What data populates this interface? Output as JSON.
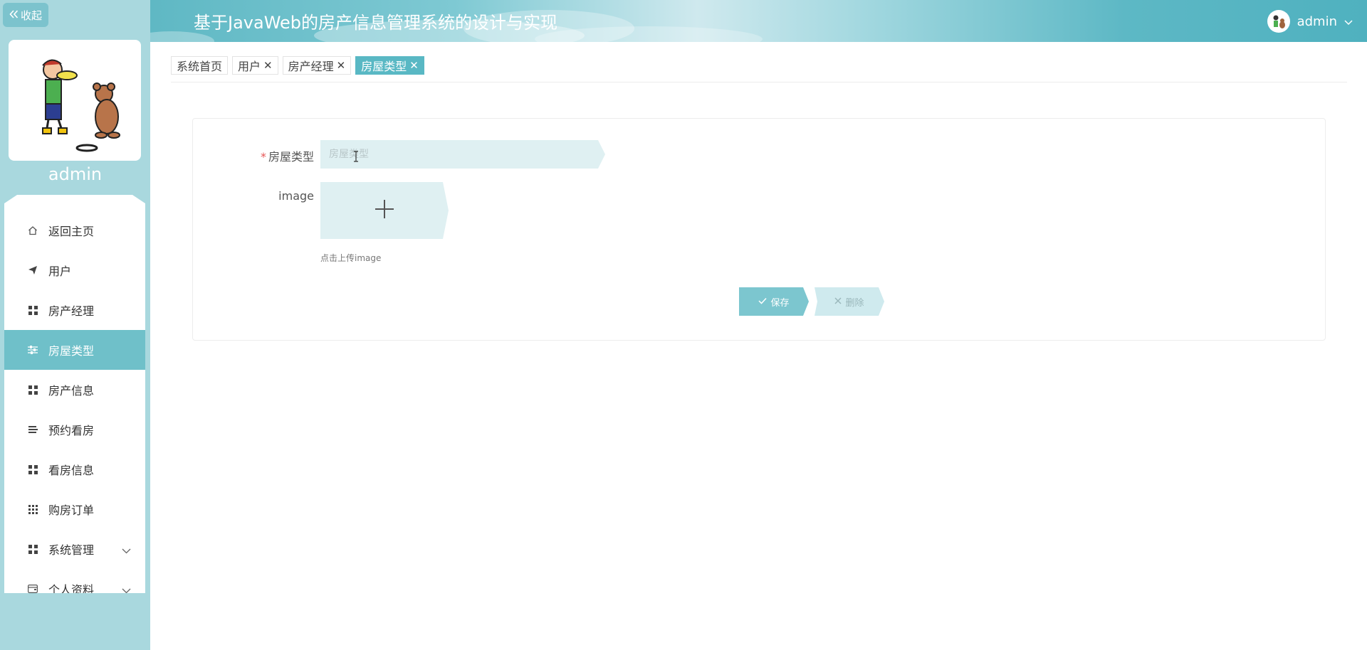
{
  "sidebar": {
    "collapse_label": "收起",
    "username": "admin",
    "menu": [
      {
        "label": "返回主页",
        "icon": "home-icon",
        "active": false
      },
      {
        "label": "用户",
        "icon": "paper-plane-icon",
        "active": false
      },
      {
        "label": "房产经理",
        "icon": "grid-icon",
        "active": false
      },
      {
        "label": "房屋类型",
        "icon": "sliders-icon",
        "active": true
      },
      {
        "label": "房产信息",
        "icon": "grid-icon",
        "active": false
      },
      {
        "label": "预约看房",
        "icon": "list-icon",
        "active": false
      },
      {
        "label": "看房信息",
        "icon": "grid-icon",
        "active": false
      },
      {
        "label": "购房订单",
        "icon": "dots-grid-icon",
        "active": false
      },
      {
        "label": "系统管理",
        "icon": "grid-icon",
        "active": false,
        "expandable": true
      },
      {
        "label": "个人资料",
        "icon": "wallet-icon",
        "active": false,
        "expandable": true
      }
    ]
  },
  "header": {
    "title": "基于JavaWeb的房产信息管理系统的设计与实现",
    "user": "admin"
  },
  "tabs": [
    {
      "label": "系统首页",
      "closable": false,
      "active": false
    },
    {
      "label": "用户",
      "closable": true,
      "active": false
    },
    {
      "label": "房产经理",
      "closable": true,
      "active": false
    },
    {
      "label": "房屋类型",
      "closable": true,
      "active": true
    }
  ],
  "form": {
    "type_label": "房屋类型",
    "type_placeholder": "房屋类型",
    "image_label": "image",
    "upload_hint": "点击上传image",
    "save_label": "保存",
    "delete_label": "删除"
  },
  "colors": {
    "accent": "#59b8c4",
    "sidebar_bg": "#a9d8de",
    "input_bg": "#dff0f2",
    "required": "#e65656"
  }
}
